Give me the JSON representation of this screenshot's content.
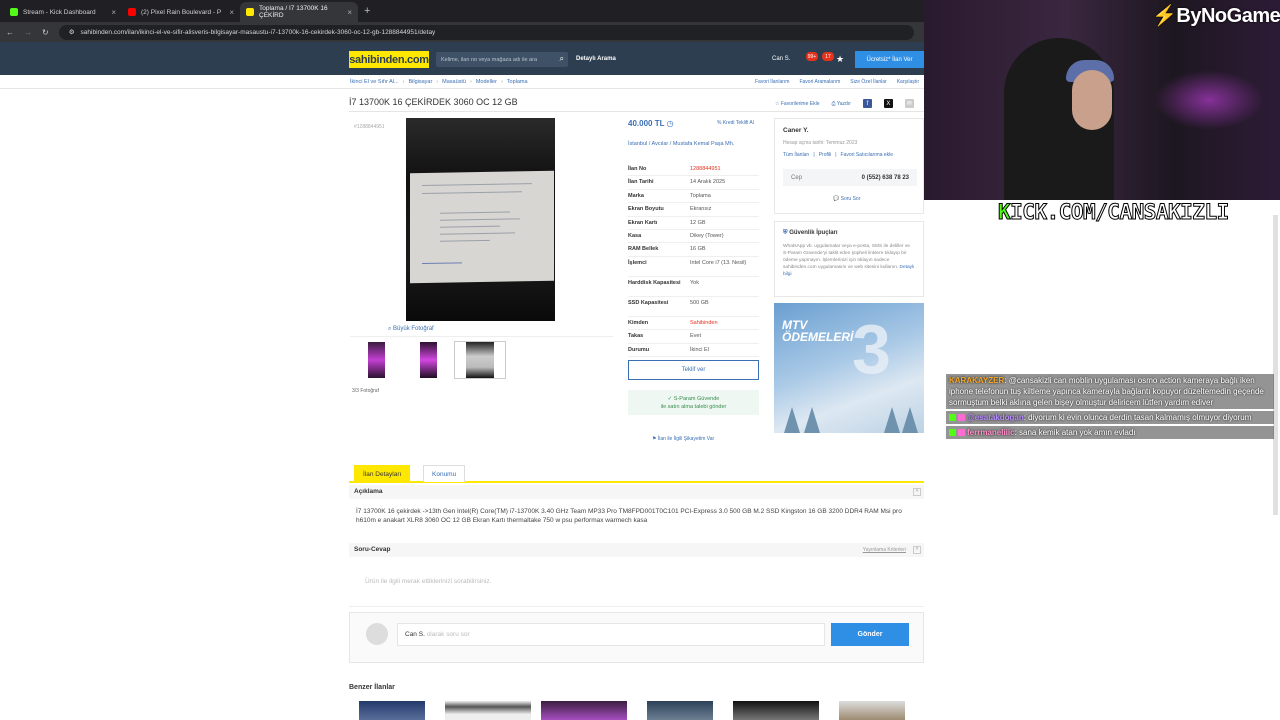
{
  "browser": {
    "tabs": [
      {
        "label": "Stream - Kick Dashboard",
        "color": "#53fc18",
        "active": false
      },
      {
        "label": "(2) Pixel Rain Boulevard - P",
        "color": "#ff0000",
        "active": false
      },
      {
        "label": "Toplama / I7 13700K 16 ÇEKİRD",
        "color": "#ffe800",
        "active": true
      }
    ],
    "url": "sahibinden.com/ilan/ikinci-el-ve-sifir-alisveris-bilgisayar-masaustu-i7-13700k-16-cekirdek-3060-oc-12-gb-1288844951/detay"
  },
  "header": {
    "logo": "sahibinden.com",
    "search_placeholder": "Kelime, ilan no veya mağaza adı ile ara",
    "advanced": "Detaylı Arama",
    "user": "Can S.",
    "badge1": "99+",
    "badge2": "17",
    "post_button": "Ücretsiz* İlan Ver"
  },
  "breadcrumbs": [
    "İkinci El ve Sıfır Al...",
    "Bilgisayar",
    "Masaüstü",
    "Modeller",
    "Toplama"
  ],
  "right_links": [
    "Favori İlanlarım",
    "Favori Aramalarım",
    "Size Özel İlanlar",
    "Karşılaştır"
  ],
  "listing": {
    "title": "İ7 13700K 16 ÇEKİRDEK 3060 OC 12 GB",
    "fav": "Favorilerime Ekle",
    "print": "Yazdır",
    "small_no": "#1288844951",
    "big_photo": "Büyük Fotoğraf",
    "photo_count": "3/3 Fotoğraf",
    "price": "40.000 TL",
    "credit": "Kredi Teklifi Al",
    "location": "İstanbul / Avcılar / Mustafa Kemal Paşa Mh.",
    "details": [
      {
        "k": "İlan No",
        "v": "1288844951",
        "red": true
      },
      {
        "k": "İlan Tarihi",
        "v": "14 Aralık 2025"
      },
      {
        "k": "Marka",
        "v": "Toplama"
      },
      {
        "k": "Ekran Boyutu",
        "v": "Ekransız"
      },
      {
        "k": "Ekran Kartı",
        "v": "12 GB"
      },
      {
        "k": "Kasa",
        "v": "Dikey (Tower)"
      },
      {
        "k": "RAM Bellek",
        "v": "16 GB"
      },
      {
        "k": "İşlemci",
        "v": "Intel Core i7 (13. Nesil)"
      },
      {
        "k": "Harddisk Kapasitesi",
        "v": "Yok"
      },
      {
        "k": "SSD Kapasitesi",
        "v": "500 GB"
      },
      {
        "k": "Kimden",
        "v": "Sahibinden",
        "red": true
      },
      {
        "k": "Takas",
        "v": "Evet"
      },
      {
        "k": "Durumu",
        "v": "İkinci El"
      }
    ],
    "offer": "Teklif ver",
    "safe_title": "S-Param Güvende",
    "safe_sub": "ile satın alma talebi gönder",
    "complain": "İlan ile İlgili Şikayetim Var"
  },
  "seller": {
    "name": "Caner Y.",
    "since": "Hesap açma tarihi: Temmuz 2023",
    "links": [
      "Tüm İlanları",
      "Profili",
      "Favori Satıcılarıma ekle"
    ],
    "phone_label": "Cep",
    "phone": "0 (552) 638 78 23",
    "ask": "Soru Sor"
  },
  "tips": {
    "title": "Güvenlik İpuçları",
    "text": "WhatsApp vb. uygulamalar veya e-posta, SMS ile deliller ve S-Param Güvende'yi taklit eden şüpheli linklere tıklayıp bir ödeme yapmayın. İşlemlerinizi için tıklayın sadece sahibinden.com uygulamasını ve web sitesini kullanın.",
    "more": "Detaylı bilgi"
  },
  "ad": {
    "line1": "MTV",
    "line2": "ÖDEMELERİ",
    "num": "3"
  },
  "tabs2": [
    "İlan Detayları",
    "Konumu"
  ],
  "description": {
    "title": "Açıklama",
    "text": "İ7 13700K 16 çekirdek ->13th Gen Intel(R) Core(TM) i7-13700K 3.40 GHz Team MP33 Pro TM8FPD001T0C101 PCI-Express 3.0 500 GB M.2 SSD Kingston 16 GB 3200 DDR4 RAM Msi pro h610m e anakart XLR8 3060 OC 12 GB Ekran Kartı thermaltake 750 w psu performax warmech kasa"
  },
  "qa": {
    "title": "Soru-Cevap",
    "rules": "Yayınlama Kriterleri",
    "placeholder": "Ürün ile ilgili merak ettiklerinizi sorabilirsiniz.",
    "user": "Can S.",
    "reply_placeholder": "olarak soru sor",
    "send": "Gönder"
  },
  "similar": "Benzer İlanlar",
  "overlay": {
    "brand": "ByNoGame",
    "kick_k": "K",
    "kick_rest": "ICK.COM/CANSAKIZLI",
    "chat": [
      {
        "user": "KARAKAYZER",
        "color": "#f5a623",
        "text": ": @cansakizli can moblin uygulaması osmo action kameraya bağlı iken iphone telefonun tuş kiltleme yapınca kamerayla bağlantı kopuyor düzeltemedin geçende sormuştum belki aklına gelen bişey olmuştur deliricem lütfen yardım ediver"
      },
      {
        "user": "@esatakdogan",
        "color": "#b78cff",
        "text": ": diyorum ki evin olunca derdin tasan kalmamış olmuyor diyorum"
      },
      {
        "user": "ferrmaneliiic",
        "color": "#ff8fc8",
        "text": ": sana kemik atan yok amın evladı"
      }
    ]
  }
}
